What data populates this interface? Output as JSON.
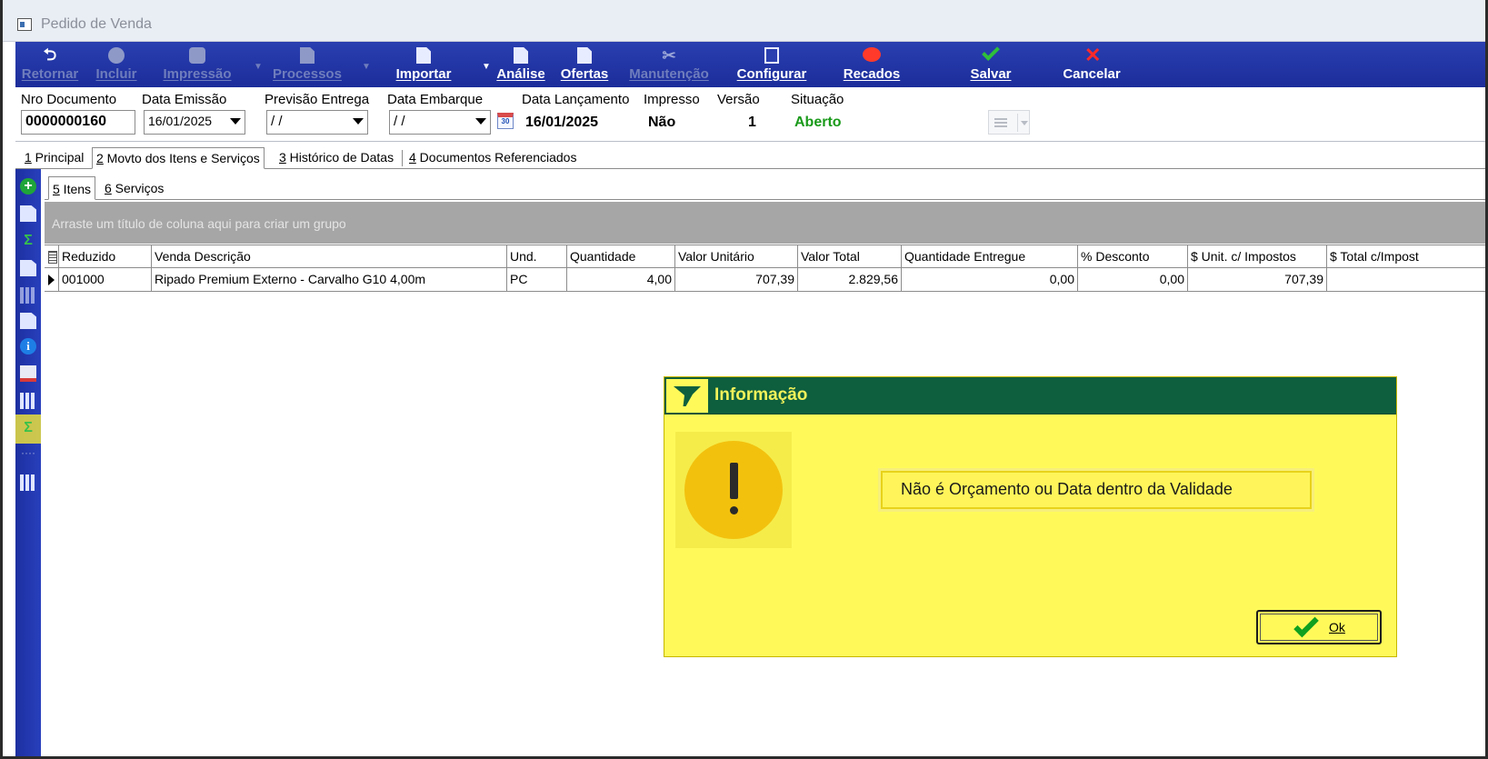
{
  "window": {
    "title": "Pedido de Venda"
  },
  "toolbar": {
    "buttons": [
      {
        "label": "Retornar",
        "icon": "back-arrow-icon",
        "enabled": false
      },
      {
        "label": "Incluir",
        "icon": "plus-circle-icon",
        "enabled": false
      },
      {
        "label": "Impressão",
        "icon": "printer-icon",
        "enabled": false
      },
      {
        "label": "Processos",
        "icon": "gear-doc-icon",
        "enabled": false
      },
      {
        "label": "Importar",
        "icon": "import-doc-icon",
        "enabled": true
      },
      {
        "label": "Análise",
        "icon": "analysis-doc-icon",
        "enabled": true
      },
      {
        "label": "Ofertas",
        "icon": "offers-doc-icon",
        "enabled": true
      },
      {
        "label": "Manutenção",
        "icon": "tools-icon",
        "enabled": false
      },
      {
        "label": "Configurar",
        "icon": "configure-icon",
        "enabled": true
      },
      {
        "label": "Recados",
        "icon": "message-bubble-icon",
        "enabled": true
      },
      {
        "label": "Salvar",
        "icon": "check-icon",
        "enabled": true
      },
      {
        "label": "Cancelar",
        "icon": "cross-icon",
        "enabled": true
      }
    ]
  },
  "header": {
    "nro_documento": {
      "label": "Nro Documento",
      "value": "0000000160"
    },
    "data_emissao": {
      "label": "Data Emissão",
      "value": "16/01/2025"
    },
    "previsao_entrega": {
      "label": "Previsão Entrega",
      "value": " / /"
    },
    "data_embarque": {
      "label": "Data Embarque",
      "value": " / /"
    },
    "data_lancamento": {
      "label": "Data Lançamento",
      "value": "16/01/2025"
    },
    "impresso": {
      "label": "Impresso",
      "value": "Não"
    },
    "versao": {
      "label": "Versão",
      "value": "1"
    },
    "situacao": {
      "label": "Situação",
      "value": "Aberto",
      "color": "#1a9a1a"
    }
  },
  "tabs": [
    {
      "key": "1",
      "label": " Principal",
      "active": false
    },
    {
      "key": "2",
      "label": " Movto dos Itens e Serviços",
      "active": true
    },
    {
      "key": "3",
      "label": " Histórico de Datas",
      "active": false
    },
    {
      "key": "4",
      "label": " Documentos Referenciados",
      "active": false
    }
  ],
  "subtabs": [
    {
      "key": "5",
      "label": " Itens",
      "active": true
    },
    {
      "key": "6",
      "label": " Serviços",
      "active": false
    }
  ],
  "grid": {
    "group_hint": "Arraste um título de coluna aqui para criar um grupo",
    "columns": [
      "Reduzido",
      "Venda Descrição",
      "Und.",
      "Quantidade",
      "Valor Unitário",
      "Valor Total",
      "Quantidade Entregue",
      "% Desconto",
      "$ Unit. c/ Impostos",
      "$ Total c/Impost"
    ],
    "rows": [
      [
        "001000",
        "Ripado Premium Externo - Carvalho G10 4,00m",
        "PC",
        "4,00",
        "707,39",
        "2.829,56",
        "0,00",
        "0,00",
        "707,39",
        ""
      ]
    ]
  },
  "dialog": {
    "title": "Informação",
    "message": "Não é Orçamento ou Data dentro da Validade",
    "ok_label": "Ok",
    "icon": "warning-exclamation-icon",
    "accent": "#0e5f3e",
    "background": "#fffa5a"
  }
}
